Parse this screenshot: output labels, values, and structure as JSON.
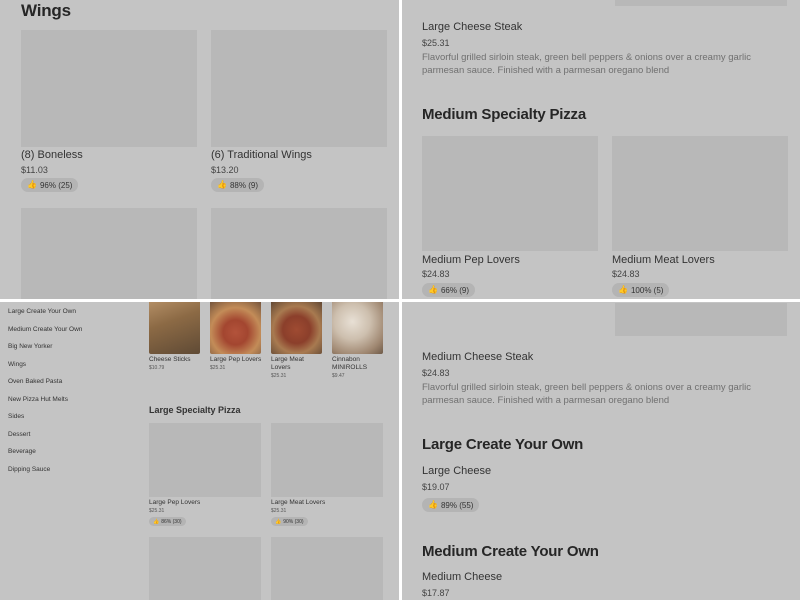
{
  "q1": {
    "section_title": "Wings",
    "items": [
      {
        "name": "(8) Boneless",
        "price": "$11.03",
        "rating": "96% (25)"
      },
      {
        "name": "(6) Traditional Wings",
        "price": "$13.20",
        "rating": "88% (9)"
      }
    ]
  },
  "q2": {
    "top_item": {
      "name": "Large Cheese Steak",
      "price": "$25.31",
      "description": "Flavorful grilled sirloin steak, green bell peppers & onions over a creamy garlic parmesan sauce. Finished with a parmesan oregano blend"
    },
    "section_title": "Medium Specialty Pizza",
    "items": [
      {
        "name": "Medium Pep Lovers",
        "price": "$24.83",
        "rating": "66% (9)"
      },
      {
        "name": "Medium Meat Lovers",
        "price": "$24.83",
        "rating": "100% (5)"
      }
    ]
  },
  "q3": {
    "sidebar": [
      "Large Create Your Own",
      "Medium Create Your Own",
      "Big New Yorker",
      "Wings",
      "Oven Baked Pasta",
      "New Pizza Hut Melts",
      "Sides",
      "Dessert",
      "Beverage",
      "Dipping Sauce"
    ],
    "featured": [
      {
        "name": "Cheese Sticks",
        "price": "$10.79"
      },
      {
        "name": "Large Pep Lovers",
        "price": "$25.31"
      },
      {
        "name": "Large Meat Lovers",
        "price": "$25.31"
      },
      {
        "name": "Cinnabon MINIROLLS",
        "price": "$9.47"
      }
    ],
    "section_title": "Large Specialty Pizza",
    "items": [
      {
        "name": "Large Pep Lovers",
        "price": "$25.31",
        "rating": "86% (30)"
      },
      {
        "name": "Large Meat Lovers",
        "price": "$25.31",
        "rating": "90% (30)"
      }
    ]
  },
  "q4": {
    "top_item": {
      "name": "Medium Cheese Steak",
      "price": "$24.83",
      "description": "Flavorful grilled sirloin steak, green bell peppers & onions over a creamy garlic parmesan sauce. Finished with a parmesan oregano blend"
    },
    "section1_title": "Large Create Your Own",
    "item1": {
      "name": "Large Cheese",
      "price": "$19.07",
      "rating": "89% (55)"
    },
    "section2_title": "Medium Create Your Own",
    "item2": {
      "name": "Medium Cheese",
      "price": "$17.87"
    }
  },
  "icons": {
    "thumb": "thumbs-up-icon"
  }
}
